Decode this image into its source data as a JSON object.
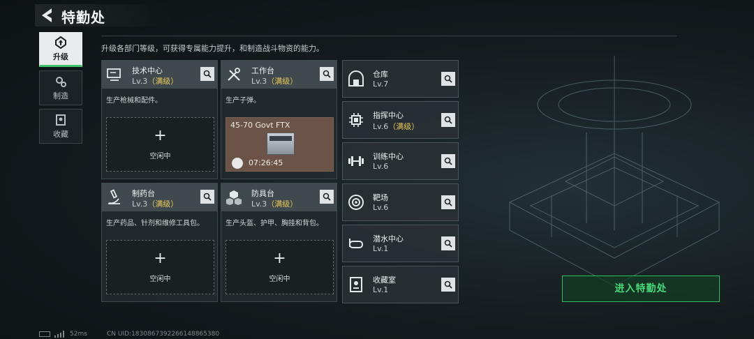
{
  "header": {
    "title": "特勤处"
  },
  "sidebar": {
    "items": [
      {
        "label": "升级",
        "icon": "upgrade-icon",
        "active": true
      },
      {
        "label": "制造",
        "icon": "gears-icon",
        "active": false
      },
      {
        "label": "收藏",
        "icon": "collection-icon",
        "active": false
      }
    ]
  },
  "description": "升级各部门等级，可获得专属能力提升，和制造战斗物资的能力。",
  "departments": [
    {
      "name": "技术中心",
      "level": "Lv.3",
      "status": "（满级）",
      "desc": "生产枪械和配件。",
      "slot": {
        "plus": "+",
        "label": "空闲中"
      }
    },
    {
      "name": "工作台",
      "level": "Lv.3",
      "status": "（满级）",
      "desc": "生产子弹。",
      "crafting": {
        "item": "45-70 Govt FTX",
        "time": "07:26:45"
      }
    },
    {
      "name": "制药台",
      "level": "Lv.3",
      "status": "（满级）",
      "desc": "生产药品、针剂和维修工具包。",
      "slot": {
        "plus": "+",
        "label": "空闲中"
      }
    },
    {
      "name": "防具台",
      "level": "Lv.3",
      "status": "（满级）",
      "desc": "生产头盔、护甲、胸挂和背包。",
      "slot": {
        "plus": "+",
        "label": "空闲中"
      }
    }
  ],
  "facilities": [
    {
      "name": "仓库",
      "level": "Lv.7",
      "status": "",
      "icon": "warehouse-icon"
    },
    {
      "name": "指挥中心",
      "level": "Lv.6",
      "status": "（满级）",
      "icon": "command-chip-icon"
    },
    {
      "name": "训练中心",
      "level": "Lv.6",
      "status": "",
      "icon": "dumbbell-icon"
    },
    {
      "name": "靶场",
      "level": "Lv.6",
      "status": "",
      "icon": "target-icon"
    },
    {
      "name": "潜水中心",
      "level": "Lv.1",
      "status": "",
      "icon": "diving-mask-icon"
    },
    {
      "name": "收藏室",
      "level": "Lv.1",
      "status": "",
      "icon": "collection-room-icon"
    }
  ],
  "enter_button": "进入特勤处",
  "status_bar": {
    "ping": "52ms",
    "uid": "CN UID:1830867392266148865380"
  },
  "colors": {
    "accent_green": "#3ec46d",
    "maxed_gold": "#e8c75a",
    "crafting_brown": "#6b5447"
  }
}
